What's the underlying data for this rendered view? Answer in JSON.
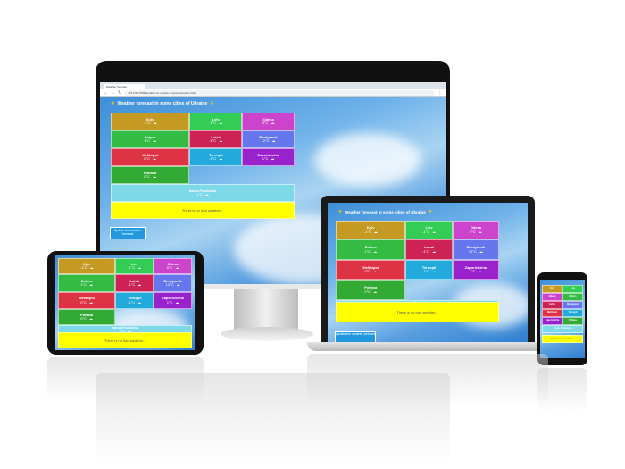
{
  "app": {
    "title": "Weather forecast in some cities of Ukraine",
    "tab_title": "Weather forecast",
    "address": "127.0.0.1:5500/weather-in-ukraine-responsive/index.html",
    "update_button": "Update the weather forecast",
    "smog_text": "There is no bad weather..."
  },
  "cities": [
    {
      "name": "Kyiv",
      "temp": "-1°C",
      "icon": "cloud-sun-icon"
    },
    {
      "name": "Lviv",
      "temp": "-1°C",
      "icon": "cloud-sun-icon"
    },
    {
      "name": "Odesa",
      "temp": "0°C",
      "icon": "cloud-sun-icon"
    },
    {
      "name": "Dnipro",
      "temp": "1°C",
      "icon": "cloud-sun-icon"
    },
    {
      "name": "Lutsk",
      "temp": "-1°C",
      "icon": "cloud-sun-icon"
    },
    {
      "name": "Berdyansk",
      "temp": "12°C",
      "icon": "cloud-sun-icon"
    },
    {
      "name": "Melitopol",
      "temp": "0°C",
      "icon": "cloud-sun-icon"
    },
    {
      "name": "Ternopil",
      "temp": "-1°C",
      "icon": "cloud-sun-icon"
    },
    {
      "name": "Zaporizhzhia",
      "temp": "1°C",
      "icon": "cloud-sun-icon"
    },
    {
      "name": "Poltava",
      "temp": "0°C",
      "icon": "cloud-icon"
    },
    {
      "name": "Ivano-Frankivsk",
      "temp": "1°C",
      "icon": "cloud-icon"
    }
  ],
  "colors": {
    "kyiv": "#c49a22",
    "lviv": "#33cc55",
    "odesa": "#cc44cc",
    "dnipro": "#33bb44",
    "lutsk": "#cc2255",
    "berdyansk": "#6677ee",
    "melitopol": "#dd3344",
    "ternopil": "#22aadd",
    "zaporizhzhia": "#9922cc",
    "poltava": "#33aa33",
    "ivano_frankivsk": "#7dd8e8",
    "smog": "#ffff00"
  }
}
